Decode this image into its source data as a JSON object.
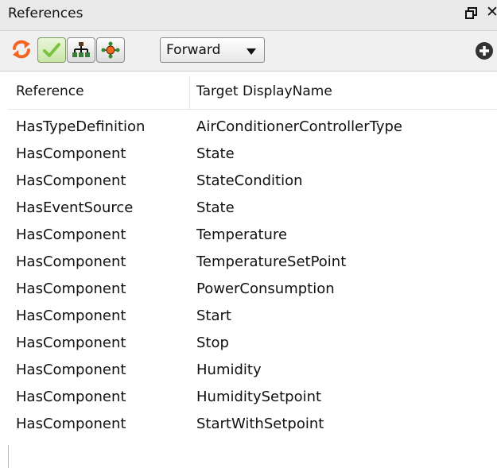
{
  "panel": {
    "title": "References"
  },
  "toolbar": {
    "direction": "Forward",
    "icons": [
      "refresh-icon",
      "check-icon",
      "hierarchy-icon",
      "node-graph-icon",
      "add-icon"
    ]
  },
  "table": {
    "columns": [
      "Reference",
      "Target DisplayName"
    ],
    "rows": [
      {
        "reference": "HasTypeDefinition",
        "target": "AirConditionerControllerType"
      },
      {
        "reference": "HasComponent",
        "target": "State"
      },
      {
        "reference": "HasComponent",
        "target": "StateCondition"
      },
      {
        "reference": "HasEventSource",
        "target": "State"
      },
      {
        "reference": "HasComponent",
        "target": "Temperature"
      },
      {
        "reference": "HasComponent",
        "target": "TemperatureSetPoint"
      },
      {
        "reference": "HasComponent",
        "target": "PowerConsumption"
      },
      {
        "reference": "HasComponent",
        "target": "Start"
      },
      {
        "reference": "HasComponent",
        "target": "Stop"
      },
      {
        "reference": "HasComponent",
        "target": "Humidity"
      },
      {
        "reference": "HasComponent",
        "target": "HumiditySetpoint"
      },
      {
        "reference": "HasComponent",
        "target": "StartWithSetpoint"
      }
    ]
  },
  "colors": {
    "accent_orange": "#f26522",
    "check_green": "#7cc242",
    "titlebar": "#e9e9e9",
    "toolbar": "#f0f0f0"
  }
}
